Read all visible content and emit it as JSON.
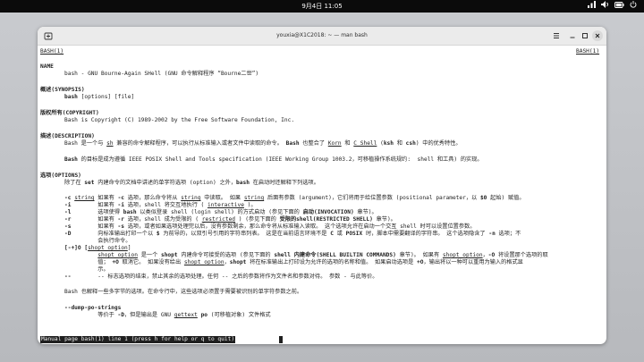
{
  "system_bar": {
    "clock": "9月4日  11:05",
    "tray": {
      "network_icon": "network-icon",
      "volume_icon": "volume-icon",
      "battery_icon": "battery-icon",
      "power_icon": "power-icon"
    }
  },
  "window": {
    "title": "youxia@X1C2018: ~ — man bash"
  },
  "man": {
    "header_left": "BASH(1)",
    "header_right": "BASH(1)",
    "name_heading": "NAME",
    "name_text": "bash - GNU Bourne-Again SHell (GNU 命令解释程序 “Bourne二世”)",
    "synopsis_heading": "概述(SYNOPSIS)",
    "synopsis_cmd": "bash",
    "synopsis_args": " [options] [file]",
    "copyright_heading": "版权所有(COPYRIGHT)",
    "copyright_text": "Bash is Copyright (C) 1989-2002 by the Free Software Foundation, Inc.",
    "description_heading": "描述(DESCRIPTION)",
    "desc1": [
      "Bash 是一个与 ",
      "sh",
      " 兼容的命令解释程序，可以执行从标准输入或者文件中读取的命令。 ",
      "Bash",
      " 也整合了 ",
      "Korn",
      " 和 ",
      "C Shell",
      " (",
      "ksh",
      " 和 ",
      "csh",
      ") 中的优秀特性。"
    ],
    "desc2": [
      "Bash",
      " 的目标是成为遵循 IEEE POSIX Shell and Tools specification (IEEE Working Group 1003.2，可移植操作系统规约:  shell 和工具) 的实现。"
    ],
    "options_heading": "选项(OPTIONS)",
    "options_intro": [
      "除了在 ",
      "set",
      " 内建命令的文档中讲述的单字符选项 (option) 之外，",
      "bash",
      " 在启动时还解释下列选项。"
    ],
    "opt_c": [
      "-c ",
      "string",
      " 如果有 ",
      "-c",
      " 选项，那么命令将从 ",
      "string",
      " 中读取。 如果 ",
      "string",
      " 后面有参数 (argument)，它们将用于给位置参数 (positional parameter，以 ",
      "$0",
      " 起始) 赋值。"
    ],
    "opt_i": [
      "-i",
      "        如果有 ",
      "-i",
      " 选项，shell 将交互地执行 ( ",
      "interactive",
      " )。"
    ],
    "opt_l": [
      "-l",
      "        选项使得 ",
      "bash",
      " 以类似登录 shell (login shell) 的方式启动 (参见下面的 ",
      "启动(INVOCATION)",
      " 章节)。"
    ],
    "opt_r": [
      "-r",
      "        如果有 ",
      "-r",
      " 选项，shell 成为受限的 ( ",
      "restricted",
      " ) (参见下面的 ",
      "受限的shell(RESTRICTED SHELL)",
      " 章节)。"
    ],
    "opt_s": [
      "-s",
      "        如果有 ",
      "-s",
      " 选项，或者如果选项处理完以后，没有参数剩余，那么命令将从标准输入读取。 这个选项允许在启动一个交互 shell 时可以设置位置参数。"
    ],
    "opt_D1": [
      "-D",
      "        向标准输出打印一个以 ",
      "$",
      " 为前导的，以双引号引用的字符串列表。 这是在当前语言环境不是 ",
      "C",
      " 或 ",
      "POSIX",
      " 时，脚本中需要翻译的字符串。 这个选项隐含了 ",
      "-n",
      " 选项；不"
    ],
    "opt_D2": "          会执行命令。",
    "opt_O": [
      "[-+]O [",
      "shopt_option",
      "]"
    ],
    "opt_O_1": [
      "          ",
      "shopt_option",
      " 是一个 ",
      "shopt",
      " 内建命令可接受的选项 (参见下面的 ",
      "shell 内建命令(SHELL BUILTIN COMMANDS)",
      " 章节)。 如果有 ",
      "shopt_option",
      "，",
      "-O",
      " 将设置那个选项的取"
    ],
    "opt_O_2": [
      "          值； ",
      "+O",
      " 取消它。 如果没有给出 ",
      "shopt_option",
      "，",
      "shopt",
      " 将在标准输出上打印设为允许的选项的名称和值。 如果启动选项是 ",
      "+O",
      "，输出将以一种可以重用为输入的格式显"
    ],
    "opt_O_3": "          示。",
    "opt_dash": [
      "--",
      "        -- 标志选项的结束，禁止其余的选项处理。任何 -- 之后的参数将作为文件名和参数对待。 参数 - 与此等价。"
    ],
    "multi_char": "Bash 也解释一些多字节的选项。在命令行中，这些选项必须置于需要被识别的单字符参数之前。",
    "dump_opt": "--dump-po-strings",
    "dump_desc": [
      "          等价于 ",
      "-D",
      "，但是输出是 GNU ",
      "gettext",
      " ",
      "po",
      " (可移植对象) 文件格式"
    ],
    "status_line": "Manual page bash(1) line 1 (press h for help or q to quit)"
  }
}
